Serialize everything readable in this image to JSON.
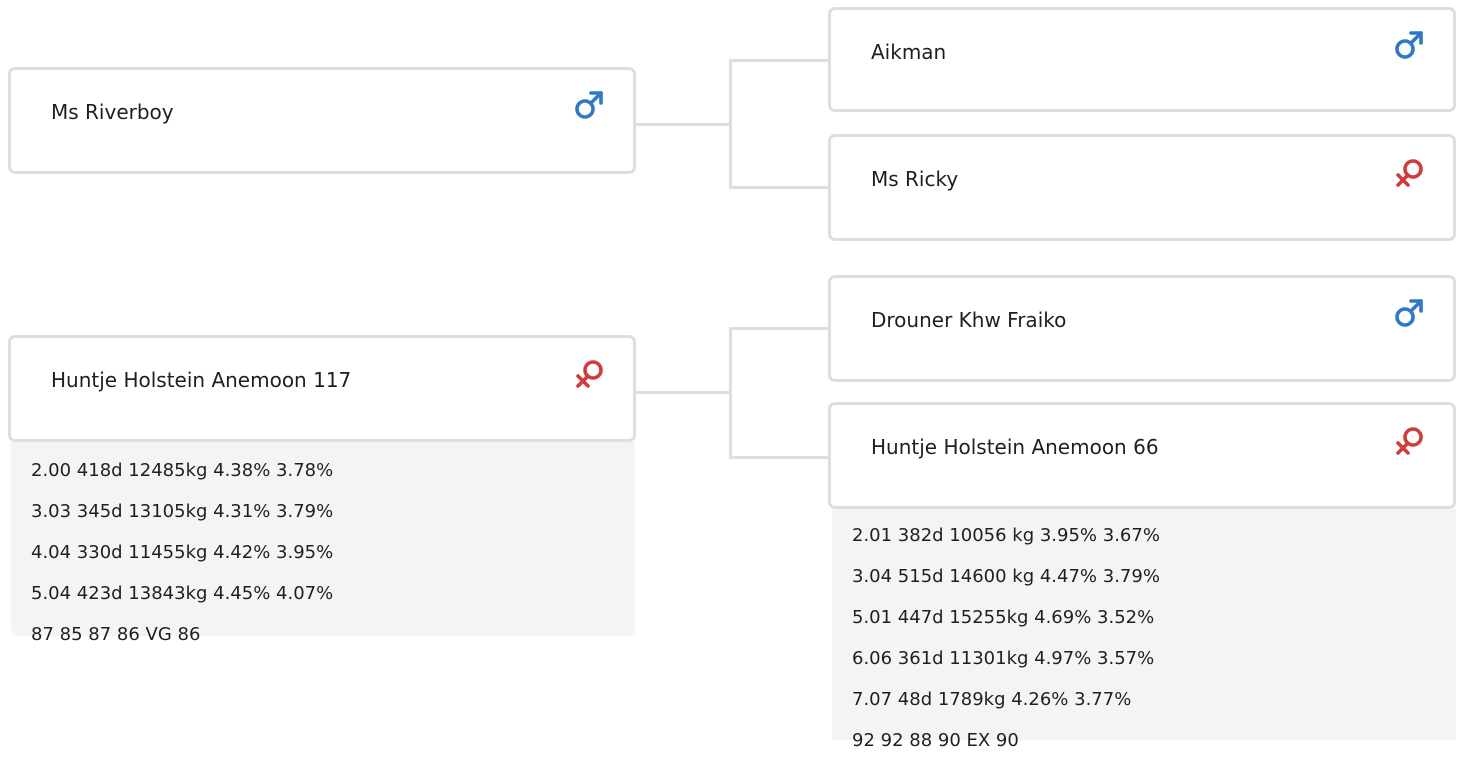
{
  "pedigree": {
    "sire": {
      "name": "Ms Riverboy",
      "sex": "male",
      "sex_icon": "male-icon"
    },
    "dam": {
      "name": "Huntje Holstein Anemoon 117",
      "sex": "female",
      "sex_icon": "female-icon",
      "details": [
        "2.00 418d 12485kg 4.38% 3.78%",
        "3.03 345d 13105kg 4.31% 3.79%",
        "4.04 330d 11455kg 4.42% 3.95%",
        "5.04 423d 13843kg 4.45% 4.07%",
        "87 85 87 86 VG 86"
      ]
    },
    "sire_sire": {
      "name": "Aikman",
      "sex": "male",
      "sex_icon": "male-icon"
    },
    "sire_dam": {
      "name": "Ms Ricky",
      "sex": "female",
      "sex_icon": "female-icon"
    },
    "dam_sire": {
      "name": "Drouner Khw Fraiko",
      "sex": "male",
      "sex_icon": "male-icon"
    },
    "dam_dam": {
      "name": "Huntje Holstein Anemoon 66",
      "sex": "female",
      "sex_icon": "female-icon",
      "details": [
        "2.01 382d 10056 kg 3.95% 3.67%",
        "3.04 515d 14600 kg 4.47% 3.79%",
        "5.01 447d 15255kg 4.69% 3.52%",
        "6.06 361d 11301kg 4.97% 3.57%",
        "7.07 48d 1789kg 4.26% 3.77%",
        "92 92 88 90 EX 90"
      ]
    }
  },
  "colors": {
    "male": "#2f78c4",
    "female": "#d23b3b",
    "border": "#dedede",
    "details_bg": "#f4f4f4"
  }
}
